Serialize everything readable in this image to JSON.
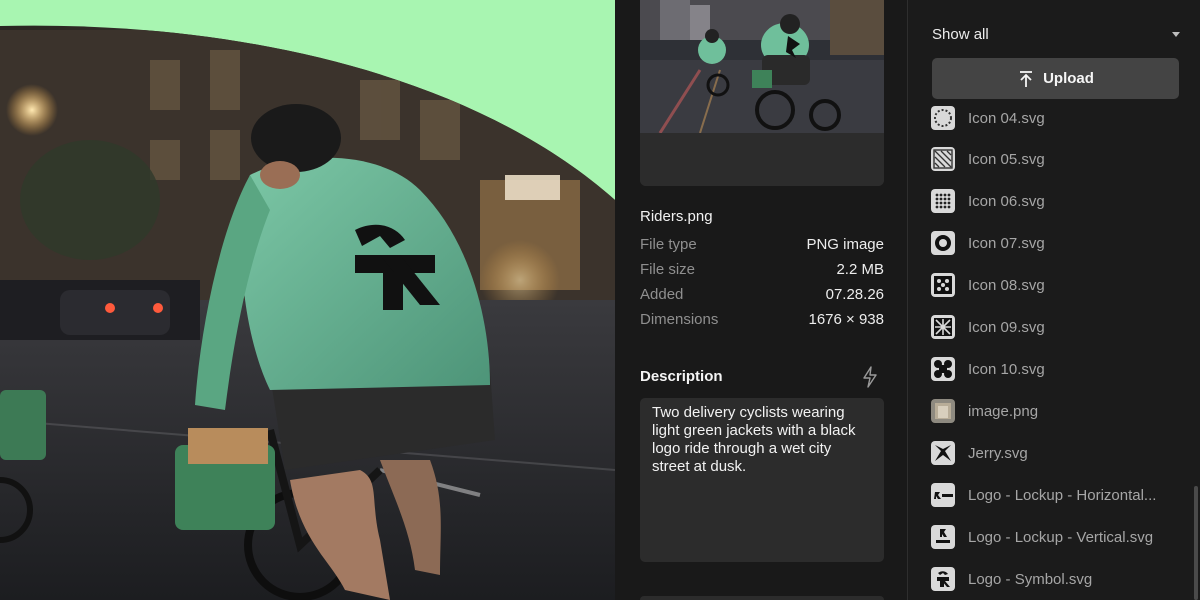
{
  "canvas": {
    "background_color": "#a8f5b1"
  },
  "inspector": {
    "file_name": "Riders.png",
    "meta": [
      {
        "label": "File type",
        "value": "PNG image"
      },
      {
        "label": "File size",
        "value": "2.2 MB"
      },
      {
        "label": "Added",
        "value": "07.28.26"
      },
      {
        "label": "Dimensions",
        "value": "1676 × 938"
      }
    ],
    "description_title": "Description",
    "description_text": "Two delivery cyclists wearing light green jackets with a black logo ride through a wet city street at dusk.",
    "generate_icon": "bolt-icon"
  },
  "library": {
    "filter_label": "Show all",
    "upload_label": "Upload",
    "upload_icon": "upload-arrow-icon",
    "files": [
      {
        "name": "Icon 04.svg",
        "icon": "icon-04"
      },
      {
        "name": "Icon 05.svg",
        "icon": "icon-05"
      },
      {
        "name": "Icon 06.svg",
        "icon": "icon-06"
      },
      {
        "name": "Icon 07.svg",
        "icon": "icon-07"
      },
      {
        "name": "Icon 08.svg",
        "icon": "icon-08"
      },
      {
        "name": "Icon 09.svg",
        "icon": "icon-09"
      },
      {
        "name": "Icon 10.svg",
        "icon": "icon-10"
      },
      {
        "name": "image.png",
        "icon": "image"
      },
      {
        "name": "Jerry.svg",
        "icon": "jerry"
      },
      {
        "name": "Logo - Lockup - Horizontal...",
        "icon": "logo-horizontal"
      },
      {
        "name": "Logo - Lockup - Vertical.svg",
        "icon": "logo-vertical"
      },
      {
        "name": "Logo - Symbol.svg",
        "icon": "logo-symbol"
      }
    ]
  },
  "colors": {
    "accent_green": "#a8f5b1",
    "jacket_green": "#5fa98a",
    "panel": "#191919",
    "field": "#2c2c2c"
  }
}
